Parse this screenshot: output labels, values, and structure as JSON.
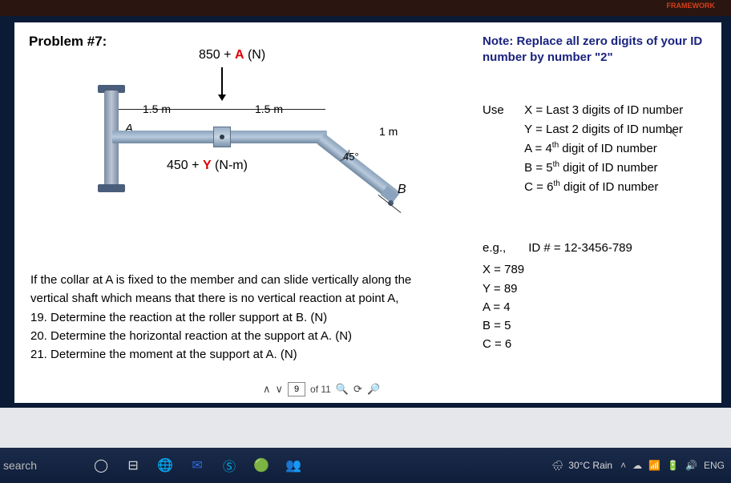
{
  "top": {
    "framework": "FRAMEWORK"
  },
  "problem": {
    "title": "Problem #7:",
    "force_prefix": "850 + ",
    "force_var": "A",
    "force_unit": " (N)",
    "torque_prefix": "450 + ",
    "torque_var": "Y",
    "torque_unit": " (N-m)",
    "dim_1_5_left": "1.5 m",
    "dim_1_5_right": "1.5 m",
    "dim_1m": "1 m",
    "angle": "45°",
    "label_A": "A",
    "label_B": "B"
  },
  "note": {
    "line1": "Note: Replace all zero digits of your ID",
    "line2": "number by number \"2\""
  },
  "use": {
    "label": "Use",
    "lines": {
      "x": "X = Last 3 digits of ID number",
      "y": "Y = Last 2 digits of ID number",
      "a_pre": "A = 4",
      "a_sup": "th",
      "a_post": " digit of ID number",
      "b_pre": "B = 5",
      "b_sup": "th",
      "b_post": " digit of ID number",
      "c_pre": "C = 6",
      "c_sup": "th",
      "c_post": " digit of ID number"
    }
  },
  "eg": {
    "label": "e.g.,",
    "id": "ID # = 12-3456-789",
    "x": "X = 789",
    "y": "Y = 89",
    "a": "A = 4",
    "b": "B = 5",
    "c": "C = 6"
  },
  "body": {
    "l1": "If the collar at A is fixed to the member and can slide vertically along the",
    "l2": "vertical shaft which means that there is no vertical reaction at point A,",
    "l3": "19. Determine the reaction at the roller support at B. (N)",
    "l4": "20. Determine the horizontal reaction at the support at A. (N)",
    "l5": "21. Determine the moment at the support at A. (N)"
  },
  "pagenav": {
    "current": "9",
    "of_label": "of 11"
  },
  "taskbar": {
    "search": "search",
    "weather": "30°C Rain",
    "lang": "ENG"
  }
}
